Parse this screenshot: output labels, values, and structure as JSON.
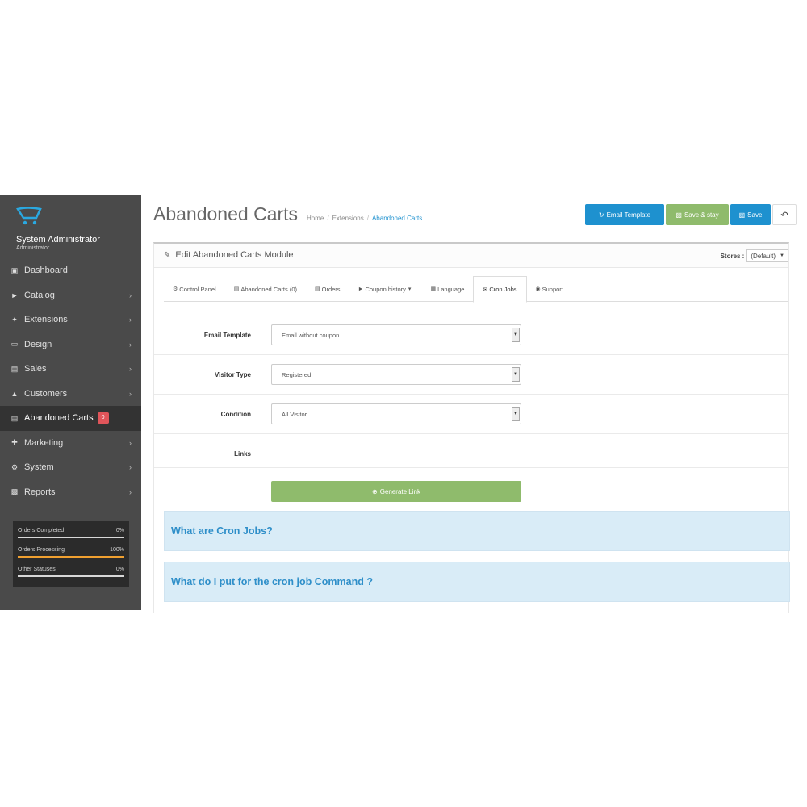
{
  "profile": {
    "name": "System Administrator",
    "role": "Administrator"
  },
  "sidebar": {
    "items": [
      {
        "label": "Dashboard",
        "icon": "dashboard-icon",
        "chevron": false
      },
      {
        "label": "Catalog",
        "icon": "tag-icon",
        "chevron": true
      },
      {
        "label": "Extensions",
        "icon": "puzzle-icon",
        "chevron": true
      },
      {
        "label": "Design",
        "icon": "desktop-icon",
        "chevron": true
      },
      {
        "label": "Sales",
        "icon": "cart-icon",
        "chevron": true
      },
      {
        "label": "Customers",
        "icon": "user-icon",
        "chevron": true
      },
      {
        "label": "Abandoned Carts",
        "icon": "cart-off-icon",
        "chevron": false,
        "badge": "0",
        "active": true
      },
      {
        "label": "Marketing",
        "icon": "share-icon",
        "chevron": true
      },
      {
        "label": "System",
        "icon": "gear-icon",
        "chevron": true
      },
      {
        "label": "Reports",
        "icon": "bar-chart-icon",
        "chevron": true
      }
    ],
    "stats": [
      {
        "label": "Orders Completed",
        "value": "0%",
        "fraction": 0,
        "color": "#dddddd"
      },
      {
        "label": "Orders Processing",
        "value": "100%",
        "fraction": 1.0,
        "color": "#f0a030"
      },
      {
        "label": "Other Statuses",
        "value": "0%",
        "fraction": 0,
        "color": "#dddddd"
      }
    ]
  },
  "header": {
    "title": "Abandoned Carts",
    "breadcrumb": [
      "Home",
      "Extensions",
      "Abandoned Carts"
    ],
    "buttons": {
      "email_template": "Email Template",
      "save_stay": "Save & stay",
      "save": "Save",
      "back": "↶"
    }
  },
  "panel": {
    "title": "Edit Abandoned Carts Module",
    "stores_label": "Stores :",
    "stores_value": "(Default)"
  },
  "tabs": [
    {
      "label": "Control Panel",
      "icon": "gear-icon"
    },
    {
      "label": "Abandoned Carts (0)",
      "icon": "cart-icon"
    },
    {
      "label": "Orders",
      "icon": "cart-icon"
    },
    {
      "label": "Coupon history",
      "icon": "tags-icon",
      "caret": true
    },
    {
      "label": "Language",
      "icon": "language-icon"
    },
    {
      "label": "Cron Jobs",
      "icon": "envelope-icon",
      "active": true
    },
    {
      "label": "Support",
      "icon": "globe-icon"
    }
  ],
  "form": {
    "email_template": {
      "label": "Email Template",
      "value": "Email without coupon"
    },
    "visitor_type": {
      "label": "Visitor Type",
      "value": "Registered"
    },
    "condition": {
      "label": "Condition",
      "value": "All Visitor"
    },
    "links": {
      "label": "Links"
    },
    "generate_button": "Generate Link"
  },
  "faq": [
    "What are Cron Jobs?",
    "What do I put for the cron job Command ?"
  ],
  "colors": {
    "primary": "#1e91cf",
    "success": "#8fbb6c",
    "sidebar": "#4a4a4a",
    "badge": "#e0555a",
    "faq_bg": "#d9ecf7"
  }
}
